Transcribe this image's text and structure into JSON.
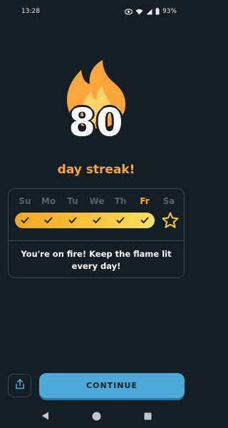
{
  "status_bar": {
    "time": "13:28",
    "battery": "93%",
    "icons": [
      "eye-icon",
      "wifi-icon",
      "signal-icon",
      "battery-icon"
    ]
  },
  "streak": {
    "count": "80",
    "label": "day streak!"
  },
  "week": {
    "days": [
      "Su",
      "Mo",
      "Tu",
      "We",
      "Th",
      "Fr",
      "Sa"
    ],
    "today_index": 5,
    "completed": [
      true,
      true,
      true,
      true,
      true,
      true,
      false
    ],
    "goal_icon": "star-icon"
  },
  "message": "You're on fire! Keep the flame lit every day!",
  "actions": {
    "share_icon": "share-icon",
    "continue_label": "CONTINUE"
  },
  "colors": {
    "background": "#131f24",
    "accent_orange": "#ffa53b",
    "bar_yellow": "#f9c63a",
    "button_blue": "#4fa9d8",
    "border": "#37464f"
  }
}
